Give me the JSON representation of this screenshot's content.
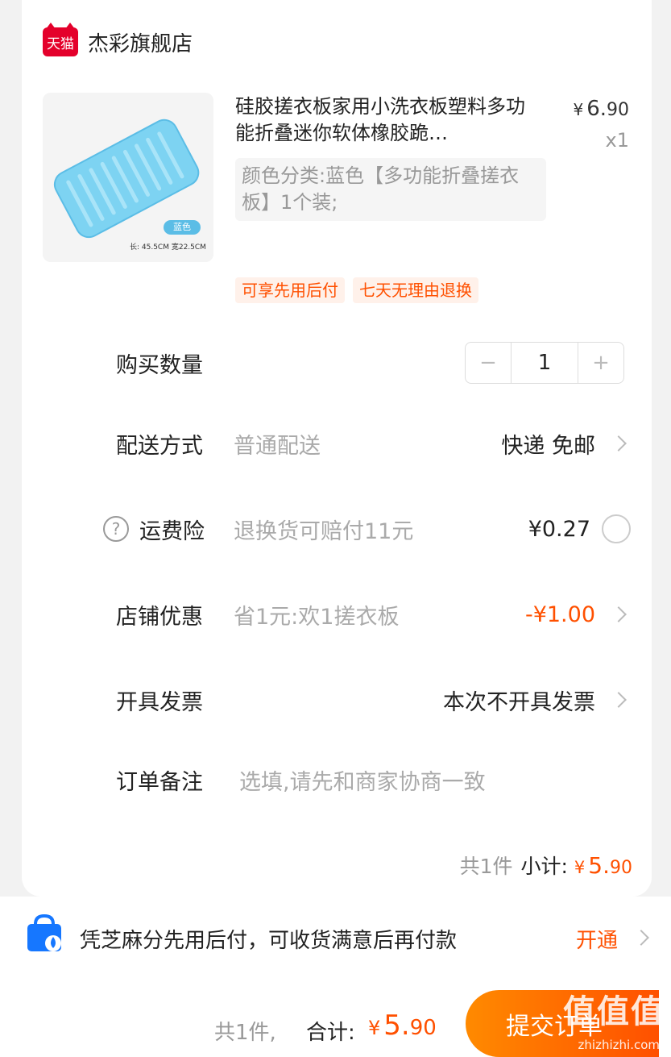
{
  "shop": {
    "logo_text": "天猫",
    "name": "杰彩旗舰店"
  },
  "product": {
    "title": "硅胶搓衣板家用小洗衣板塑料多功能折叠迷你软体橡胶跪…",
    "price_currency": "¥",
    "price_int": "6.",
    "price_dec": "90",
    "quantity": "x1",
    "sku": "颜色分类:蓝色【多功能折叠搓衣板】1个装;",
    "image_tag": "蓝色",
    "image_caption": "长: 45.5CM 宽22.5CM",
    "tags": [
      "可享先用后付",
      "七天无理由退换"
    ]
  },
  "rows": {
    "quantity": {
      "label": "购买数量",
      "minus": "−",
      "value": "1",
      "plus": "+"
    },
    "delivery": {
      "label": "配送方式",
      "sub": "普通配送",
      "right": "快递 免邮"
    },
    "insurance": {
      "icon": "?",
      "label": "运费险",
      "sub": "退换货可赔付11元",
      "right": "¥0.27"
    },
    "discount": {
      "label": "店铺优惠",
      "sub": "省1元:欢1搓衣板",
      "right": "-¥1.00"
    },
    "invoice": {
      "label": "开具发票",
      "right": "本次不开具发票"
    },
    "note": {
      "label": "订单备注",
      "placeholder": "选填,请先和商家协商一致"
    }
  },
  "subtotal": {
    "count": "共1件",
    "label": "小计:",
    "currency": "¥",
    "int": "5.",
    "dec": "90"
  },
  "paylater": {
    "text": "凭芝麻分先用后付，可收货满意后再付款",
    "action": "开通"
  },
  "bottom": {
    "count": "共1件,",
    "total_label": "合计:",
    "currency": "¥",
    "int": "5.",
    "dec": "90",
    "submit": "提交订单"
  },
  "watermark": {
    "text": "值值值",
    "url": "zhizhizhi.com"
  },
  "colors": {
    "accent": "#ff5000",
    "tmall": "#e4002b",
    "paylater_icon": "#1677ff"
  }
}
